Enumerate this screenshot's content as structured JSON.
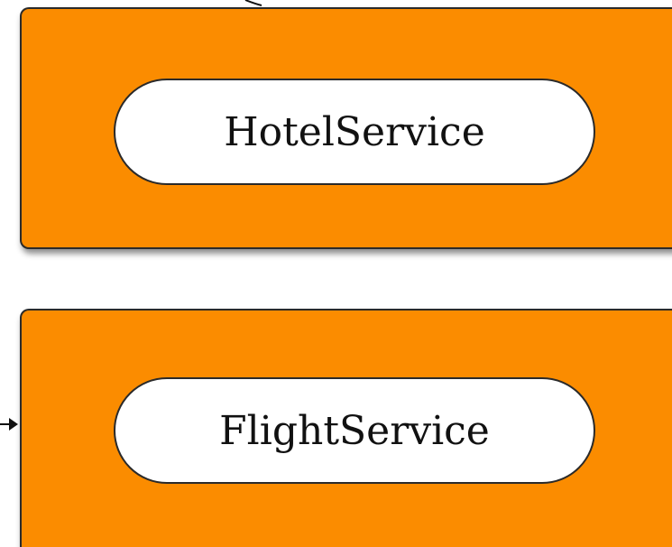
{
  "colors": {
    "box_fill": "#FB8C00",
    "box_border": "#2a2a2a",
    "pill_fill": "#ffffff"
  },
  "services": [
    {
      "label": "HotelService"
    },
    {
      "label": "FlightService"
    }
  ]
}
